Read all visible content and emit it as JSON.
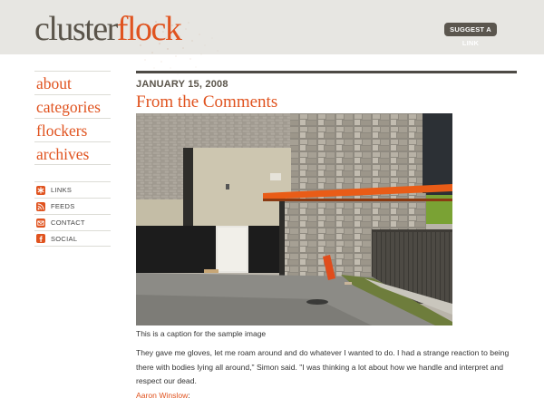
{
  "header": {
    "logo_part1": "cluster",
    "logo_part2": "flock",
    "suggest_label": "SUGGEST A LINK"
  },
  "nav": {
    "items": [
      "about",
      "categories",
      "flockers",
      "archives"
    ]
  },
  "subnav": {
    "items": [
      {
        "label": "LINKS",
        "icon": "asterisk-icon"
      },
      {
        "label": "FEEDS",
        "icon": "rss-icon"
      },
      {
        "label": "CONTACT",
        "icon": "mail-icon"
      },
      {
        "label": "SOCIAL",
        "icon": "facebook-icon"
      }
    ]
  },
  "post": {
    "date": "JANUARY 15, 2008",
    "title": "From the Comments",
    "caption": "This is a caption for the sample image",
    "body": "They gave me gloves, let me roam around and do whatever I wanted to do. I had a strange reaction to being there with bodies lying all around,\" Simon said. \"I was thinking a lot about how we handle and interpret and respect our dead.",
    "author": "Aaron Winslow",
    "author_suffix": ":"
  },
  "colors": {
    "accent": "#e0531f",
    "header_bg": "#e7e6e2",
    "text_dark": "#5a544a"
  }
}
